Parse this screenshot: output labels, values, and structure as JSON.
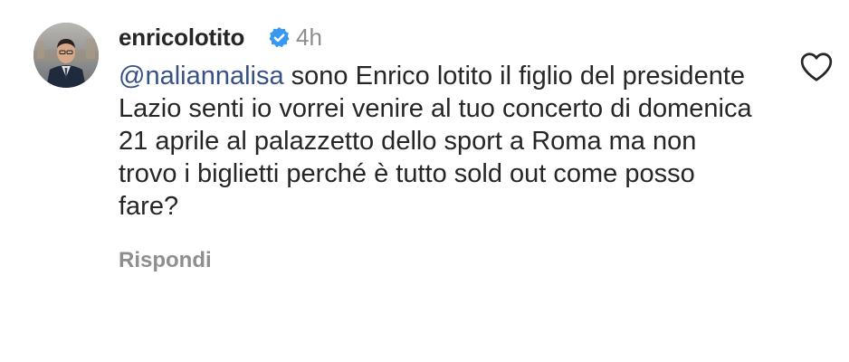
{
  "comment": {
    "username": "enricolotito",
    "verified_icon": "verified-badge-icon",
    "timestamp": "4h",
    "mention": "@naliannalisa",
    "text": " sono Enrico lotito il figlio del presidente Lazio senti io vorrei venire al tuo concerto di domenica 21 aprile al palazzetto dello sport a Roma ma non trovo i biglietti perché è tutto sold out come posso fare?",
    "reply_label": "Rispondi",
    "like_icon": "heart-outline-icon"
  },
  "colors": {
    "text": "#262626",
    "secondary": "#8e8e8e",
    "mention": "#385185",
    "verified": "#3897f0"
  }
}
